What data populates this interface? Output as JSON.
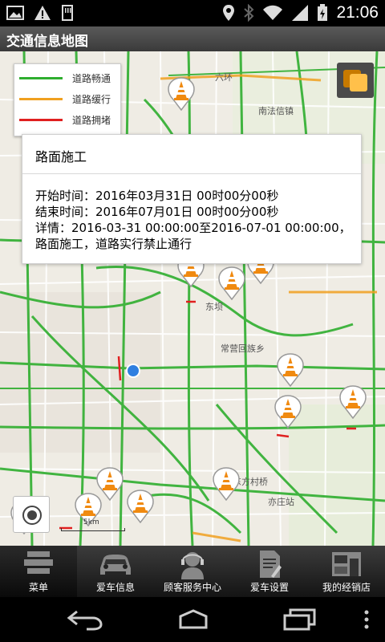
{
  "status_bar": {
    "time": "21:06"
  },
  "app": {
    "title": "交通信息地图"
  },
  "legend": [
    {
      "label": "道路畅通",
      "color": "#2fae2f"
    },
    {
      "label": "道路缓行",
      "color": "#f0a020"
    },
    {
      "label": "道路拥堵",
      "color": "#e02020"
    }
  ],
  "popup": {
    "title": "路面施工",
    "start": "开始时间：2016年03月31日 00时00分00秒",
    "end": "结束时间：2016年07月01日 00时00分00秒",
    "detail": "详情：2016-03-31 00:00:00至2016-07-01 00:00:00，路面施工，道路实行禁止通行"
  },
  "map_labels": {
    "dongba": "东坝",
    "changying": "常营回族乡",
    "dongfangcun": "东方村桥",
    "yizhuang": "亦庄站",
    "nangao": "南法信镇",
    "huan6": "六环",
    "scale": "5km"
  },
  "bottom_nav": [
    {
      "label": "菜单",
      "icon": "menu-icon"
    },
    {
      "label": "爱车信息",
      "icon": "car-icon"
    },
    {
      "label": "顾客服务中心",
      "icon": "headset-icon"
    },
    {
      "label": "爱车设置",
      "icon": "settings-doc-icon"
    },
    {
      "label": "我的经销店",
      "icon": "dealer-store-icon"
    }
  ],
  "colors": {
    "smooth": "#2fae2f",
    "slow": "#f0a020",
    "jam": "#e02020",
    "location": "#2f7fe0"
  }
}
